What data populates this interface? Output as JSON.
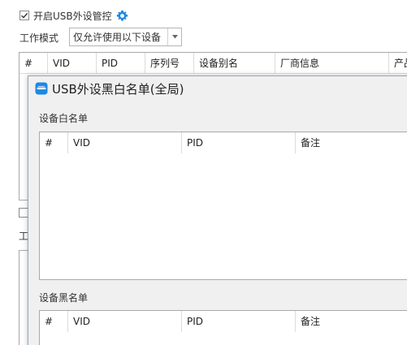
{
  "background": {
    "usb_control_checkbox_label": "开启USB外设管控",
    "usb_control_checked": true,
    "work_mode_label": "工作模式",
    "work_mode_selected": "仅允许使用以下设备",
    "device_table": {
      "columns": [
        "#",
        "VID",
        "PID",
        "序列号",
        "设备别名",
        "厂商信息",
        "产品"
      ]
    },
    "second_work_mode_label": "工作模式"
  },
  "dialog": {
    "title": "USB外设黑白名单(全局)",
    "whitelist": {
      "label": "设备白名单",
      "columns": [
        "#",
        "VID",
        "PID",
        "备注"
      ]
    },
    "blacklist": {
      "label": "设备黑名单",
      "columns": [
        "#",
        "VID",
        "PID",
        "备注"
      ]
    }
  },
  "colors": {
    "accent": "#1e88e5",
    "border": "#a9a9a9",
    "dialog_bg": "#f0f0f0"
  }
}
